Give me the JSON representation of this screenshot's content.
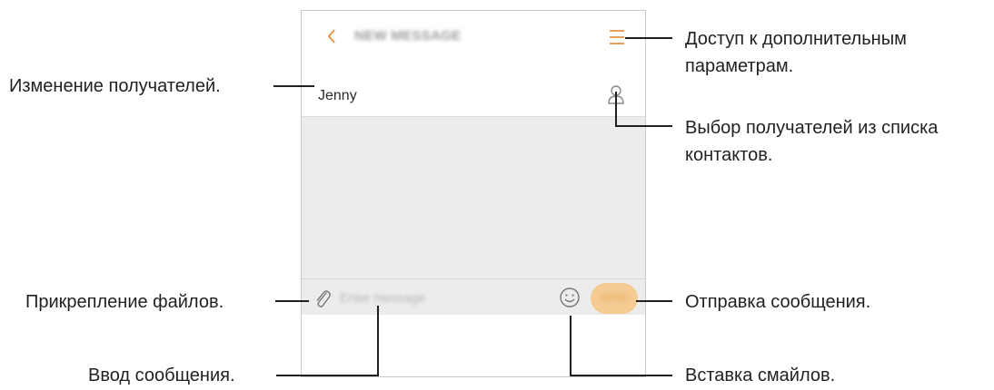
{
  "screen": {
    "title": "NEW MESSAGE",
    "recipient": "Jenny",
    "input_placeholder": "Enter message",
    "send_label": "SEND"
  },
  "icons": [
    "back-icon",
    "menu-icon",
    "contact-icon",
    "attach-icon",
    "emoji-icon"
  ],
  "colors": {
    "accent": "#e8964a",
    "send_button": "#f5cb94",
    "compose_background": "#ececec"
  },
  "callouts": {
    "more_options_line1": "Доступ к дополнительным",
    "more_options_line2": "параметрам.",
    "change_recipients": "Изменение получателей.",
    "select_contacts_line1": "Выбор получателей из списка",
    "select_contacts_line2": "контактов.",
    "attach_files": "Прикрепление файлов.",
    "send_message": "Отправка сообщения.",
    "enter_message": "Ввод сообщения.",
    "insert_emoticons": "Вставка смайлов."
  }
}
